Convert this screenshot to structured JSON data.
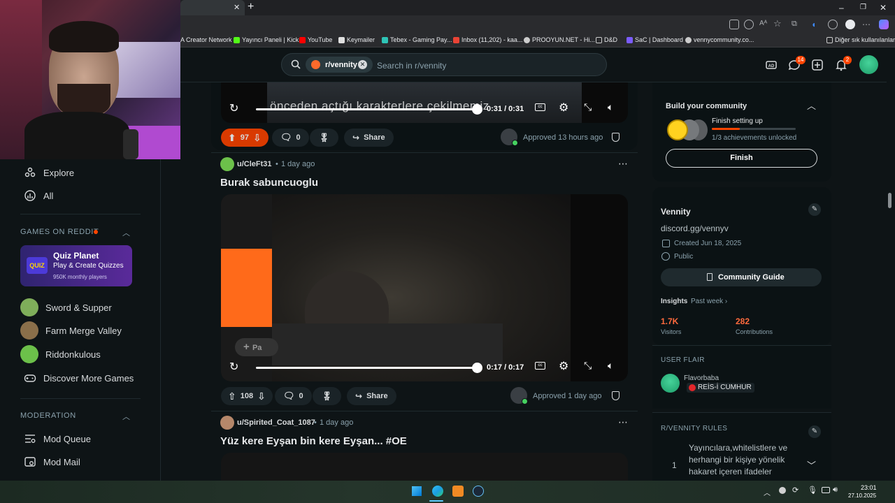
{
  "browser": {
    "bookmarks": [
      {
        "label": "A Creator Network",
        "color": "#3a7bd5"
      },
      {
        "label": "Yayıncı Paneli | Kick",
        "color": "#53fc18"
      },
      {
        "label": "YouTube",
        "color": "#ff0000"
      },
      {
        "label": "Keymailer",
        "color": "#e0e0e0"
      },
      {
        "label": "Tebex - Gaming Pay...",
        "color": "#2ec4b6"
      },
      {
        "label": "Inbox (11,202) - kaa...",
        "color": "#ea4335"
      },
      {
        "label": "PROOYUN.NET - Hi...",
        "color": "#cccccc"
      },
      {
        "label": "D&D",
        "color": "#cccccc"
      },
      {
        "label": "SaC | Dashboard",
        "color": "#7b5cff"
      },
      {
        "label": "vennycommunity.co...",
        "color": "#cccccc"
      }
    ],
    "other_bookmarks": "Diğer sık kullanılanlar",
    "new_tab": "+",
    "tab_close": "✕"
  },
  "header": {
    "subreddit_chip": "r/vennity",
    "search_placeholder": "Search in r/vennity",
    "chat_badge": "14",
    "notif_badge": "2"
  },
  "sidebar": {
    "nav": [
      {
        "label": "Explore",
        "icon": "explore-icon"
      },
      {
        "label": "All",
        "icon": "all-icon"
      }
    ],
    "games_title": "GAMES ON REDDIT",
    "quiz": {
      "title": "Quiz Planet",
      "subtitle": "Play & Create Quizzes",
      "players": "950K monthly players",
      "logo": "QUIZ"
    },
    "games": [
      {
        "label": "Sword & Supper",
        "color": "#7fae5a"
      },
      {
        "label": "Farm Merge Valley",
        "color": "#8a6f4a"
      },
      {
        "label": "Riddonkulous",
        "color": "#6cc04a"
      }
    ],
    "discover": "Discover More Games",
    "moderation_title": "MODERATION",
    "mod_items": [
      {
        "label": "Mod Queue",
        "icon": "mod-queue-icon"
      },
      {
        "label": "Mod Mail",
        "icon": "mod-mail-icon"
      }
    ]
  },
  "posts": [
    {
      "video_time": "0:31 / 0:31",
      "caption": "önceden açtığı karakterlere çekilmemiz",
      "score": "97",
      "comments": "0",
      "share": "Share",
      "approved": "Approved 13 hours ago"
    },
    {
      "author": "u/CleFt31",
      "age": "1 day ago",
      "title": "Burak sabuncuoglu",
      "video_time": "0:17 / 0:17",
      "overlay_button": "Pa",
      "score": "108",
      "comments": "0",
      "share": "Share",
      "approved": "Approved 1 day ago"
    },
    {
      "author": "u/Spirited_Coat_1087",
      "age": "1 day ago",
      "title": "Yüz kere Eyşan bin kere Eyşan... #OE"
    }
  ],
  "right": {
    "build": {
      "title": "Build your community",
      "task": "Finish setting up",
      "progress_pct": 33,
      "achievements": "1/3 achievements unlocked",
      "button": "Finish"
    },
    "community": {
      "name": "Vennity",
      "link": "discord.gg/vennyv",
      "created": "Created Jun 18, 2025",
      "visibility": "Public",
      "guide_button": "Community Guide",
      "insights": "Insights",
      "period": "Past week",
      "visitors_value": "1.7K",
      "visitors_label": "Visitors",
      "contrib_value": "282",
      "contrib_label": "Contributions",
      "accent": "#ff4500"
    },
    "flair": {
      "title": "USER FLAIR",
      "user": "Flavorbaba",
      "tag": "REİS-İ CUMHUR"
    },
    "rules": {
      "title": "R/VENNITY RULES",
      "number": "1",
      "text": "Yayıncılara,whitelistlere ve herhangi bir kişiye yönelik hakaret içeren ifadeler"
    }
  },
  "taskbar": {
    "time": "23:01",
    "date": "27.10.2025"
  }
}
